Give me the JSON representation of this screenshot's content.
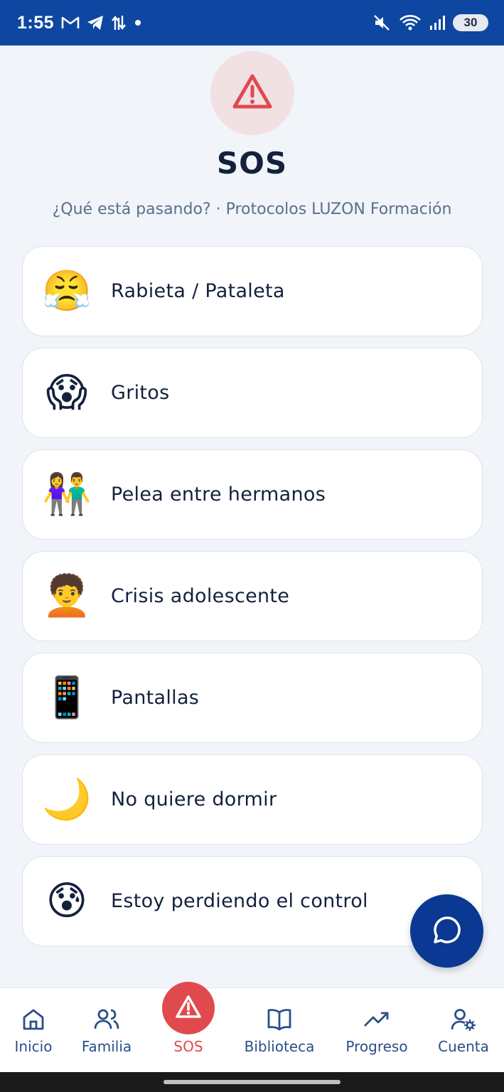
{
  "status_bar": {
    "time": "1:55",
    "battery": "30",
    "icons": [
      "gmail-icon",
      "telegram-icon",
      "data-transfer-icon",
      "dot-icon",
      "mute-icon",
      "wifi-icon",
      "signal-icon",
      "battery-icon"
    ]
  },
  "header": {
    "icon": "warning-icon",
    "title": "SOS",
    "subtitle": "¿Qué está pasando? · Protocolos LUZON Formación"
  },
  "situations": [
    {
      "emoji": "😤",
      "label": "Rabieta / Pataleta"
    },
    {
      "emoji": "😱",
      "label": "Gritos"
    },
    {
      "emoji": "👫",
      "label": "Pelea entre hermanos"
    },
    {
      "emoji": "🧑‍🦱",
      "label": "Crisis adolescente"
    },
    {
      "emoji": "📱",
      "label": "Pantallas"
    },
    {
      "emoji": "🌙",
      "label": "No quiere dormir"
    },
    {
      "emoji": "😰",
      "label": "Estoy perdiendo el control"
    }
  ],
  "fab": {
    "icon": "chat-icon"
  },
  "bottom_nav": {
    "items": [
      {
        "label": "Inicio",
        "icon": "home-icon"
      },
      {
        "label": "Familia",
        "icon": "users-icon"
      },
      {
        "label": "SOS",
        "icon": "warning-icon",
        "active": true
      },
      {
        "label": "Biblioteca",
        "icon": "book-icon"
      },
      {
        "label": "Progreso",
        "icon": "trending-up-icon"
      },
      {
        "label": "Cuenta",
        "icon": "user-settings-icon"
      }
    ]
  },
  "colors": {
    "status_bar": "#0e47a1",
    "accent_red": "#e04a4f",
    "nav_blue": "#2a4f88",
    "fab_blue": "#0a3893",
    "background": "#f1f4f8"
  }
}
